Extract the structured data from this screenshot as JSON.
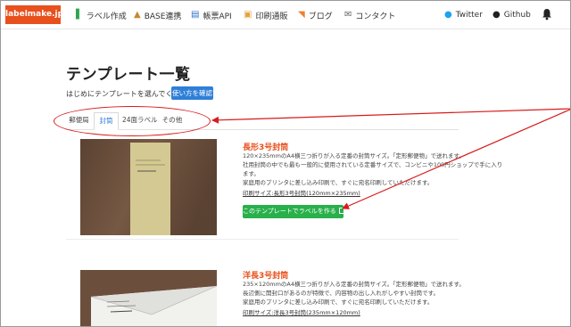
{
  "nav": {
    "brand": "labelmake.jp",
    "items": [
      {
        "label": "ラベル作成",
        "icon": "label-icon"
      },
      {
        "label": "BASE連携",
        "icon": "tree-icon"
      },
      {
        "label": "帳票API",
        "icon": "report-icon"
      },
      {
        "label": "印刷通販",
        "icon": "print-icon"
      },
      {
        "label": "ブログ",
        "icon": "rss-icon"
      },
      {
        "label": "コンタクト",
        "icon": "contact-icon"
      },
      {
        "label": "Twitter",
        "icon": "twitter-icon"
      },
      {
        "label": "Github",
        "icon": "github-icon"
      }
    ]
  },
  "main": {
    "title": "テンプレート一覧",
    "intro": "はじめにテンプレートを選んでください",
    "howto_button": "使い方を確認",
    "tabs": [
      {
        "label": "郵便局",
        "active": false
      },
      {
        "label": "封筒",
        "active": true
      },
      {
        "label": "24面ラベル",
        "active": false
      },
      {
        "label": "その他",
        "active": false
      }
    ]
  },
  "cards": [
    {
      "title": "長形3号封筒",
      "desc": [
        "120×235mmのA4横三つ折りが入る定番の封筒サイズ。「定形郵便物」で送れます。",
        "社用封筒の中でも最も一般的に使用されている定番サイズで、コンビニや100円ショップで手に入り",
        "ます。",
        "家庭用のプリンタに差し込み印刷で、すぐに宛名印刷していただけます。"
      ],
      "spec": "印刷サイズ:長形3号封筒(120mm×235mm)",
      "button": "このテンプレートでラベルを作る"
    },
    {
      "title": "洋長3号封筒",
      "desc": [
        "235×120mmのA4横三つ折りが入る定番の封筒サイズ。「定形郵便物」で送れます。",
        "長辺側に開封口があるのが特徴で、内容物の出し入れがしやすい封筒です。",
        "家庭用のプリンタに差し込み印刷で、すぐに宛名印刷していただけます。"
      ],
      "spec": "印刷サイズ:洋長3号封筒(235mm×120mm)"
    }
  ],
  "colors": {
    "brand": "#e8501d",
    "primary": "#2f7fd8",
    "success": "#28b04a",
    "annotation": "#d81a1a"
  }
}
